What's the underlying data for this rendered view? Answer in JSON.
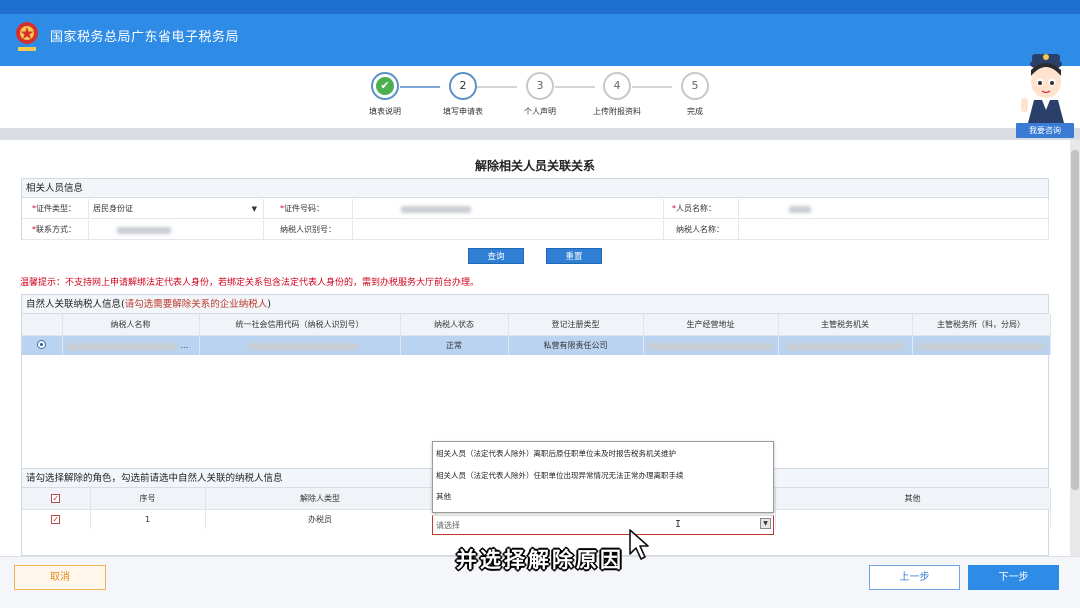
{
  "header": {
    "title": "国家税务总局广东省电子税务局"
  },
  "steps": [
    {
      "num": "1",
      "label": "填表说明",
      "state": "done"
    },
    {
      "num": "2",
      "label": "填写申请表",
      "state": "active"
    },
    {
      "num": "3",
      "label": "个人声明",
      "state": "todo"
    },
    {
      "num": "4",
      "label": "上传附报资料",
      "state": "todo"
    },
    {
      "num": "5",
      "label": "完成",
      "state": "todo"
    }
  ],
  "agent": {
    "button_label": "我要咨询"
  },
  "page": {
    "title": "解除相关人员关联关系"
  },
  "person_info": {
    "section_title": "相关人员信息",
    "id_type_label": "证件类型：",
    "id_type_value": "居民身份证",
    "id_number_label": "证件号码：",
    "person_name_label": "人员名称：",
    "contact_label": "联系方式：",
    "taxpayer_id_label": "纳税人识别号：",
    "taxpayer_name_label": "纳税人名称：",
    "required_mark": "*"
  },
  "actions": {
    "query_label": "查询",
    "reset_label": "重置"
  },
  "warning": "温馨提示：不支持网上申请解绑法定代表人身份，若绑定关系包含法定代表人身份的，需到办税服务大厅前台办理。",
  "taxpayer_section": {
    "title_prefix": "自然人关联纳税人信息(",
    "title_red": "请勾选需要解除关系的企业纳税人",
    "title_suffix": ")",
    "columns": [
      "",
      "纳税人名称",
      "统一社会信用代码（纳税人识别号）",
      "纳税人状态",
      "登记注册类型",
      "生产经营地址",
      "主管税务机关",
      "主管税务所（科，分局）"
    ],
    "rows": [
      {
        "name_suffix": "...",
        "status": "正常",
        "reg_type": "私营有限责任公司"
      }
    ]
  },
  "role_section": {
    "title": "请勾选择解除的角色，勾选前请选中自然人关联的纳税人信息",
    "columns": [
      "",
      "序号",
      "解除人类型",
      "",
      "其他"
    ],
    "rows": [
      {
        "seq": "1",
        "role": "办税员"
      }
    ]
  },
  "reason_dropdown": {
    "options": [
      "相关人员（法定代表人除外）离职后原任职单位未及时报告税务机关维护",
      "相关人员（法定代表人除外）任职单位出现异常情况无法正常办理离职手续",
      "其他"
    ],
    "placeholder": "请选择"
  },
  "footer": {
    "cancel_label": "取消",
    "prev_label": "上一步",
    "next_label": "下一步"
  },
  "subtitle": "并选择解除原因",
  "colors": {
    "header_blue": "#2f8ce6",
    "warning_red": "#d0021b",
    "selected_row": "#b9d3f0",
    "cancel_orange": "#e08a1e"
  }
}
